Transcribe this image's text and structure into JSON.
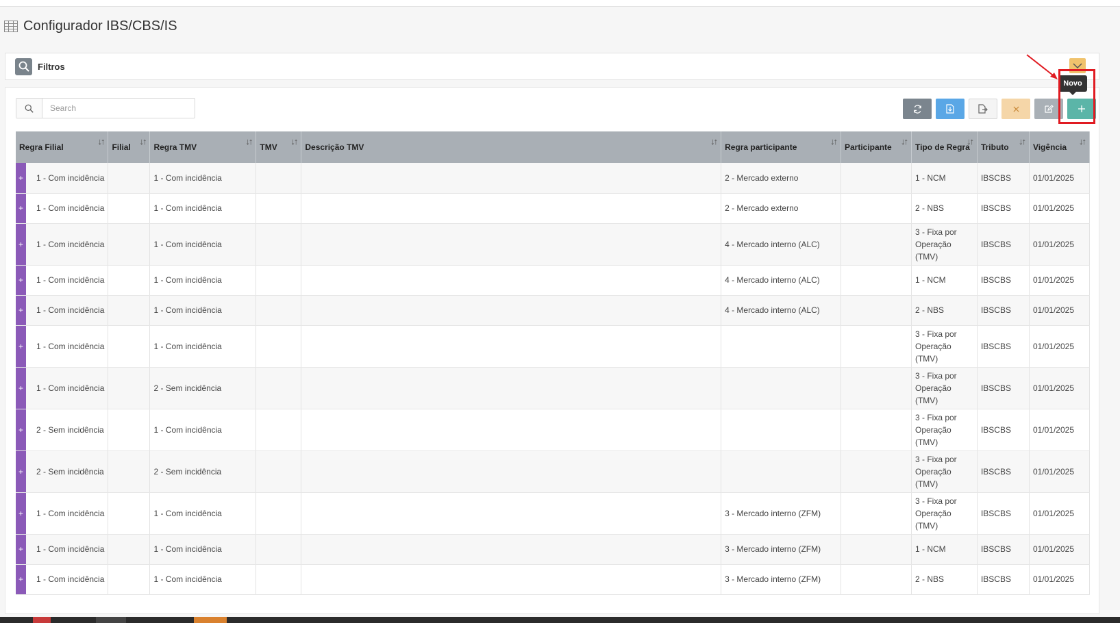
{
  "page": {
    "title": "Configurador IBS/CBS/IS"
  },
  "filters": {
    "label": "Filtros"
  },
  "search": {
    "placeholder": "Search"
  },
  "toolbar": {
    "tooltip": "Novo"
  },
  "table": {
    "headers": [
      "Regra Filial",
      "Filial",
      "Regra TMV",
      "TMV",
      "Descrição TMV",
      "Regra participante",
      "Participante",
      "Tipo de Regra",
      "Tributo",
      "Vigência"
    ],
    "rows": [
      [
        "1 - Com incidência",
        "",
        "1 - Com incidência",
        "",
        "",
        "2 - Mercado externo",
        "",
        "1 - NCM",
        "IBSCBS",
        "01/01/2025"
      ],
      [
        "1 - Com incidência",
        "",
        "1 - Com incidência",
        "",
        "",
        "2 - Mercado externo",
        "",
        "2 - NBS",
        "IBSCBS",
        "01/01/2025"
      ],
      [
        "1 - Com incidência",
        "",
        "1 - Com incidência",
        "",
        "",
        "4 - Mercado interno (ALC)",
        "",
        "3 - Fixa por Operação (TMV)",
        "IBSCBS",
        "01/01/2025"
      ],
      [
        "1 - Com incidência",
        "",
        "1 - Com incidência",
        "",
        "",
        "4 - Mercado interno (ALC)",
        "",
        "1 - NCM",
        "IBSCBS",
        "01/01/2025"
      ],
      [
        "1 - Com incidência",
        "",
        "1 - Com incidência",
        "",
        "",
        "4 - Mercado interno (ALC)",
        "",
        "2 - NBS",
        "IBSCBS",
        "01/01/2025"
      ],
      [
        "1 - Com incidência",
        "",
        "1 - Com incidência",
        "",
        "",
        "",
        "",
        "3 - Fixa por Operação (TMV)",
        "IBSCBS",
        "01/01/2025"
      ],
      [
        "1 - Com incidência",
        "",
        "2 - Sem incidência",
        "",
        "",
        "",
        "",
        "3 - Fixa por Operação (TMV)",
        "IBSCBS",
        "01/01/2025"
      ],
      [
        "2 - Sem incidência",
        "",
        "1 - Com incidência",
        "",
        "",
        "",
        "",
        "3 - Fixa por Operação (TMV)",
        "IBSCBS",
        "01/01/2025"
      ],
      [
        "2 - Sem incidência",
        "",
        "2 - Sem incidência",
        "",
        "",
        "",
        "",
        "3 - Fixa por Operação (TMV)",
        "IBSCBS",
        "01/01/2025"
      ],
      [
        "1 - Com incidência",
        "",
        "1 - Com incidência",
        "",
        "",
        "3 - Mercado interno (ZFM)",
        "",
        "3 - Fixa por Operação (TMV)",
        "IBSCBS",
        "01/01/2025"
      ],
      [
        "1 - Com incidência",
        "",
        "1 - Com incidência",
        "",
        "",
        "3 - Mercado interno (ZFM)",
        "",
        "1 - NCM",
        "IBSCBS",
        "01/01/2025"
      ],
      [
        "1 - Com incidência",
        "",
        "1 - Com incidência",
        "",
        "",
        "3 - Mercado interno (ZFM)",
        "",
        "2 - NBS",
        "IBSCBS",
        "01/01/2025"
      ]
    ]
  },
  "colors": {
    "expand": "#8b5ab8",
    "header": "#a9afb5",
    "new_button": "#5bb5a8",
    "highlight": "#e01b22"
  }
}
